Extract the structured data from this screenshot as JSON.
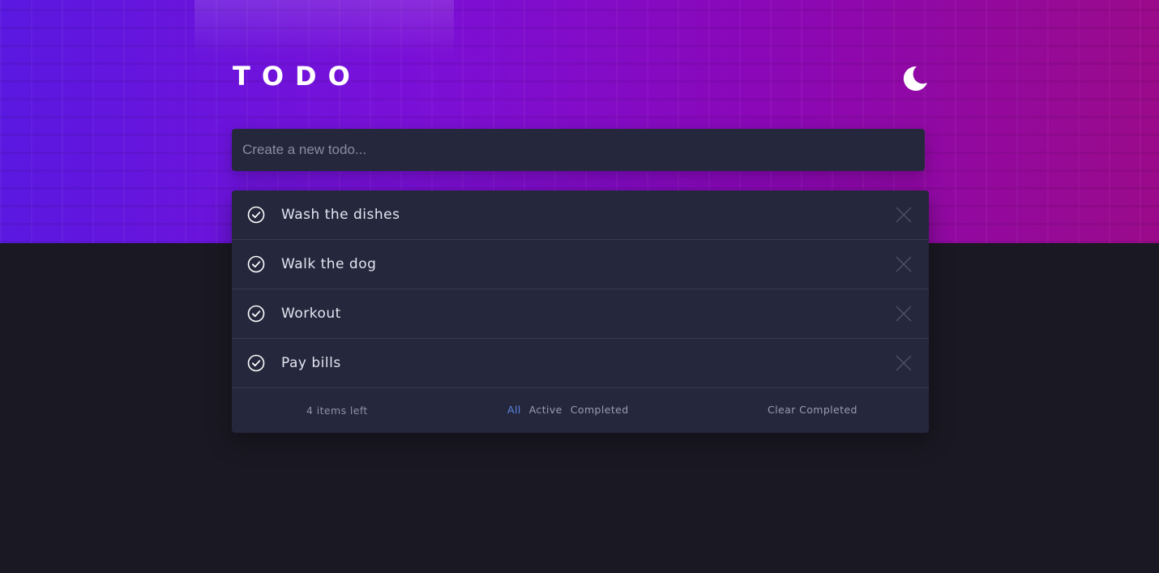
{
  "app": {
    "title": "TODO"
  },
  "new_todo": {
    "placeholder": "Create a new todo..."
  },
  "todos": [
    {
      "text": "Wash the dishes",
      "completed": true
    },
    {
      "text": "Walk the dog",
      "completed": true
    },
    {
      "text": "Workout",
      "completed": true
    },
    {
      "text": "Pay bills",
      "completed": true
    }
  ],
  "footer": {
    "items_left": "4 items left",
    "filters": {
      "all": "All",
      "active": "Active",
      "completed": "Completed"
    },
    "selected_filter": "All",
    "clear_completed": "Clear Completed"
  },
  "icons": {
    "theme_toggle": "moon-icon",
    "check": "check-circle-icon",
    "delete": "close-icon"
  },
  "colors": {
    "accent": "#5b86e5",
    "panel": "#25273c",
    "background": "#1a1822"
  }
}
